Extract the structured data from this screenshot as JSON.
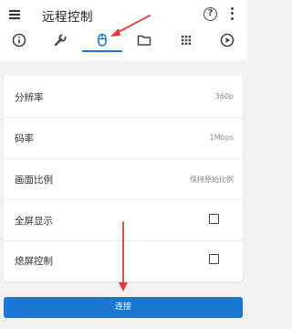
{
  "header": {
    "title": "远程控制",
    "help_icon_text": "?",
    "menu_icon": "hamburger-menu-icon",
    "help_icon": "help-circle-icon",
    "more_icon": "more-vertical-icon"
  },
  "tabs": [
    {
      "icon": "info-icon",
      "selected": false
    },
    {
      "icon": "wrench-icon",
      "selected": false
    },
    {
      "icon": "mouse-icon",
      "selected": true
    },
    {
      "icon": "folder-icon",
      "selected": false
    },
    {
      "icon": "grid-icon",
      "selected": false
    },
    {
      "icon": "play-icon",
      "selected": false
    }
  ],
  "settings": {
    "resolution": {
      "label": "分辨率",
      "value": "360p"
    },
    "bitrate": {
      "label": "码率",
      "value": "1Mbps"
    },
    "aspect": {
      "label": "画面比例",
      "value": "保持原始比例"
    },
    "fullscreen": {
      "label": "全屏显示",
      "checked": false
    },
    "screen_off": {
      "label": "熄屏控制",
      "checked": false
    }
  },
  "connect_button": {
    "label": "连接"
  },
  "colors": {
    "accent": "#1976d2",
    "annotation_arrow": "#e53935",
    "background": "#f2f2f2"
  }
}
